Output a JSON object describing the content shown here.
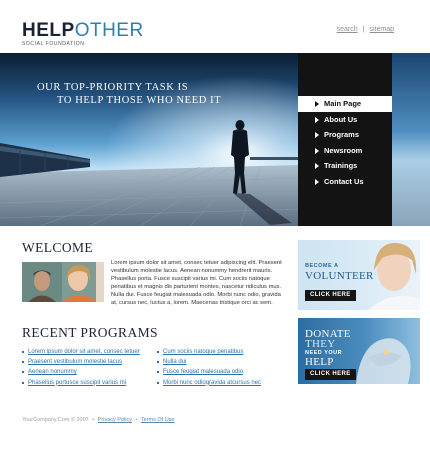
{
  "logo": {
    "part1": "HELP",
    "part2": "OTHER",
    "tagline": "SOCIAL FOUNDATION"
  },
  "top_links": [
    {
      "label": "search"
    },
    {
      "label": "sitemap"
    }
  ],
  "top_links_separator": "|",
  "hero": {
    "line1": "Our top-priority task is",
    "line2": "to help those who need it"
  },
  "nav": {
    "items": [
      {
        "label": "Main Page",
        "active": true
      },
      {
        "label": "About Us"
      },
      {
        "label": "Programs"
      },
      {
        "label": "Newsroom"
      },
      {
        "label": "Trainings"
      },
      {
        "label": "Contact Us"
      }
    ]
  },
  "welcome": {
    "title": "WELCOME",
    "body": "Lorem ipsum dolor sit amet, consec tetuer adipiscing elit. Praesent vestibulum molestie lacus. Aenean nonummy hendrerit mauris. Phasellus porta. Fusce suscipit varius mi. Cum sociis natoque penatibus et magnis dis parturient montes, nascetur ridiculus mus. Nulla dui. Fusce feugiat malesuada odio. Morbi nunc odio, gravida at, cursus nec, luctus a, lorem. Maecenas tristique orci ac sem."
  },
  "programs": {
    "title": "RECENT PROGRAMS",
    "col1": [
      "Lorem ipsum dolor sit amet, consec tetuer",
      "Praesent vestibulum molestie lacus",
      "Aenean nonummy",
      "Phasellus portusce suscipit varius mi"
    ],
    "col2": [
      "Cum sociis natoque penatibus",
      "Nulla dui",
      "Fusce feugiat malesuada odio",
      "Morbi nunc odiogravida atcursus nec"
    ]
  },
  "volunteer_banner": {
    "small": "BECOME A",
    "big": "VOLUNTEER",
    "button": "CLICK HERE"
  },
  "donate_banner": {
    "line1": "DONATE",
    "line2": "THEY",
    "line3": "NEED YOUR",
    "line4": "HELP",
    "button": "CLICK HERE"
  },
  "footer": {
    "copyright": "YourCompany.Com © 2007",
    "bullet": "•",
    "privacy": "Privacy Policy",
    "terms": "Terms Of Use"
  },
  "colors": {
    "accent": "#2a72a8",
    "dark": "#131313",
    "heading": "#1c2433"
  }
}
